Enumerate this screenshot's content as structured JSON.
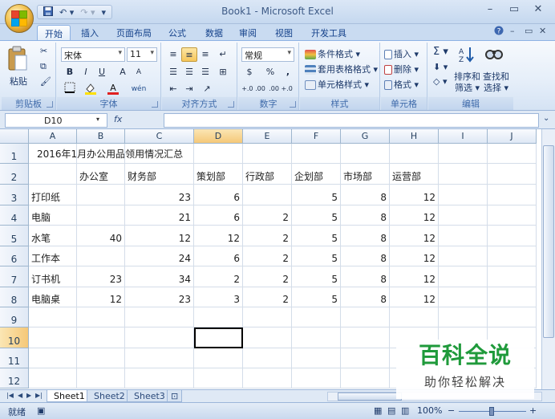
{
  "window": {
    "title": "Book1 - Microsoft Excel"
  },
  "qat": {
    "undo": "↶ ▾",
    "redo": "↷ ▾",
    "more": "▾"
  },
  "tabs": [
    {
      "label": "开始",
      "active": true
    },
    {
      "label": "插入"
    },
    {
      "label": "页面布局"
    },
    {
      "label": "公式"
    },
    {
      "label": "数据"
    },
    {
      "label": "审阅"
    },
    {
      "label": "视图"
    },
    {
      "label": "开发工具"
    }
  ],
  "ribbon": {
    "clipboard": {
      "label": "剪贴板",
      "paste": "粘贴"
    },
    "font": {
      "label": "字体",
      "name": "宋体",
      "size": "11",
      "bold": "B",
      "italic": "I",
      "underline": "U",
      "grow": "A",
      "shrink": "A",
      "wen": "wén"
    },
    "alignment": {
      "label": "对齐方式"
    },
    "number": {
      "label": "数字",
      "format": "常规",
      "percent": "%",
      "comma": ",",
      "inc": "+.0 .00",
      "dec": ".00 +.0"
    },
    "styles": {
      "label": "样式",
      "conditional": "条件格式",
      "table": "套用表格格式",
      "cell": "单元格样式"
    },
    "cells": {
      "label": "单元格",
      "insert": "插入",
      "delete": "删除",
      "format": "格式"
    },
    "editing": {
      "label": "编辑",
      "sort": "排序和\n筛选",
      "find": "查找和\n选择",
      "sort_top": "排序和",
      "sort_bottom": "筛选",
      "find_top": "查找和",
      "find_bottom": "选择"
    }
  },
  "formula_bar": {
    "name_box": "D10",
    "fx": "fx",
    "value": ""
  },
  "columns": [
    "A",
    "B",
    "C",
    "D",
    "E",
    "F",
    "G",
    "H",
    "I",
    "J"
  ],
  "rows": [
    "1",
    "2",
    "3",
    "4",
    "5",
    "6",
    "7",
    "8",
    "9",
    "10",
    "11",
    "12"
  ],
  "cells": {
    "A1": "2016年1月办公用品领用情况汇总",
    "B2": "办公室",
    "C2": "财务部",
    "D2": "策划部",
    "E2": "行政部",
    "F2": "企划部",
    "G2": "市场部",
    "H2": "运营部",
    "A3": "打印纸",
    "C3": "23",
    "D3": "6",
    "F3": "5",
    "G3": "8",
    "H3": "12",
    "A4": "电脑",
    "C4": "21",
    "D4": "6",
    "E4": "2",
    "F4": "5",
    "G4": "8",
    "H4": "12",
    "A5": "水笔",
    "B5": "40",
    "C5": "12",
    "D5": "12",
    "E5": "2",
    "F5": "5",
    "G5": "8",
    "H5": "12",
    "A6": "工作本",
    "C6": "24",
    "D6": "6",
    "E6": "2",
    "F6": "5",
    "G6": "8",
    "H6": "12",
    "A7": "订书机",
    "B7": "23",
    "C7": "34",
    "D7": "2",
    "E7": "2",
    "F7": "5",
    "G7": "8",
    "H7": "12",
    "A8": "电脑桌",
    "B8": "12",
    "C8": "23",
    "D8": "3",
    "E8": "2",
    "F8": "5",
    "G8": "8",
    "H8": "12"
  },
  "active_cell": "D10",
  "sheets": [
    {
      "label": "Sheet1",
      "active": true
    },
    {
      "label": "Sheet2"
    },
    {
      "label": "Sheet3"
    }
  ],
  "status": {
    "ready": "就绪",
    "zoom": "100%",
    "minus": "−",
    "plus": "+"
  },
  "watermark": {
    "title": "百科全说",
    "subtitle": "助你轻松解决"
  },
  "colors": {
    "accent": "#15428b",
    "selected_header": "#f5c878",
    "watermark_green": "#1f9a3b"
  }
}
